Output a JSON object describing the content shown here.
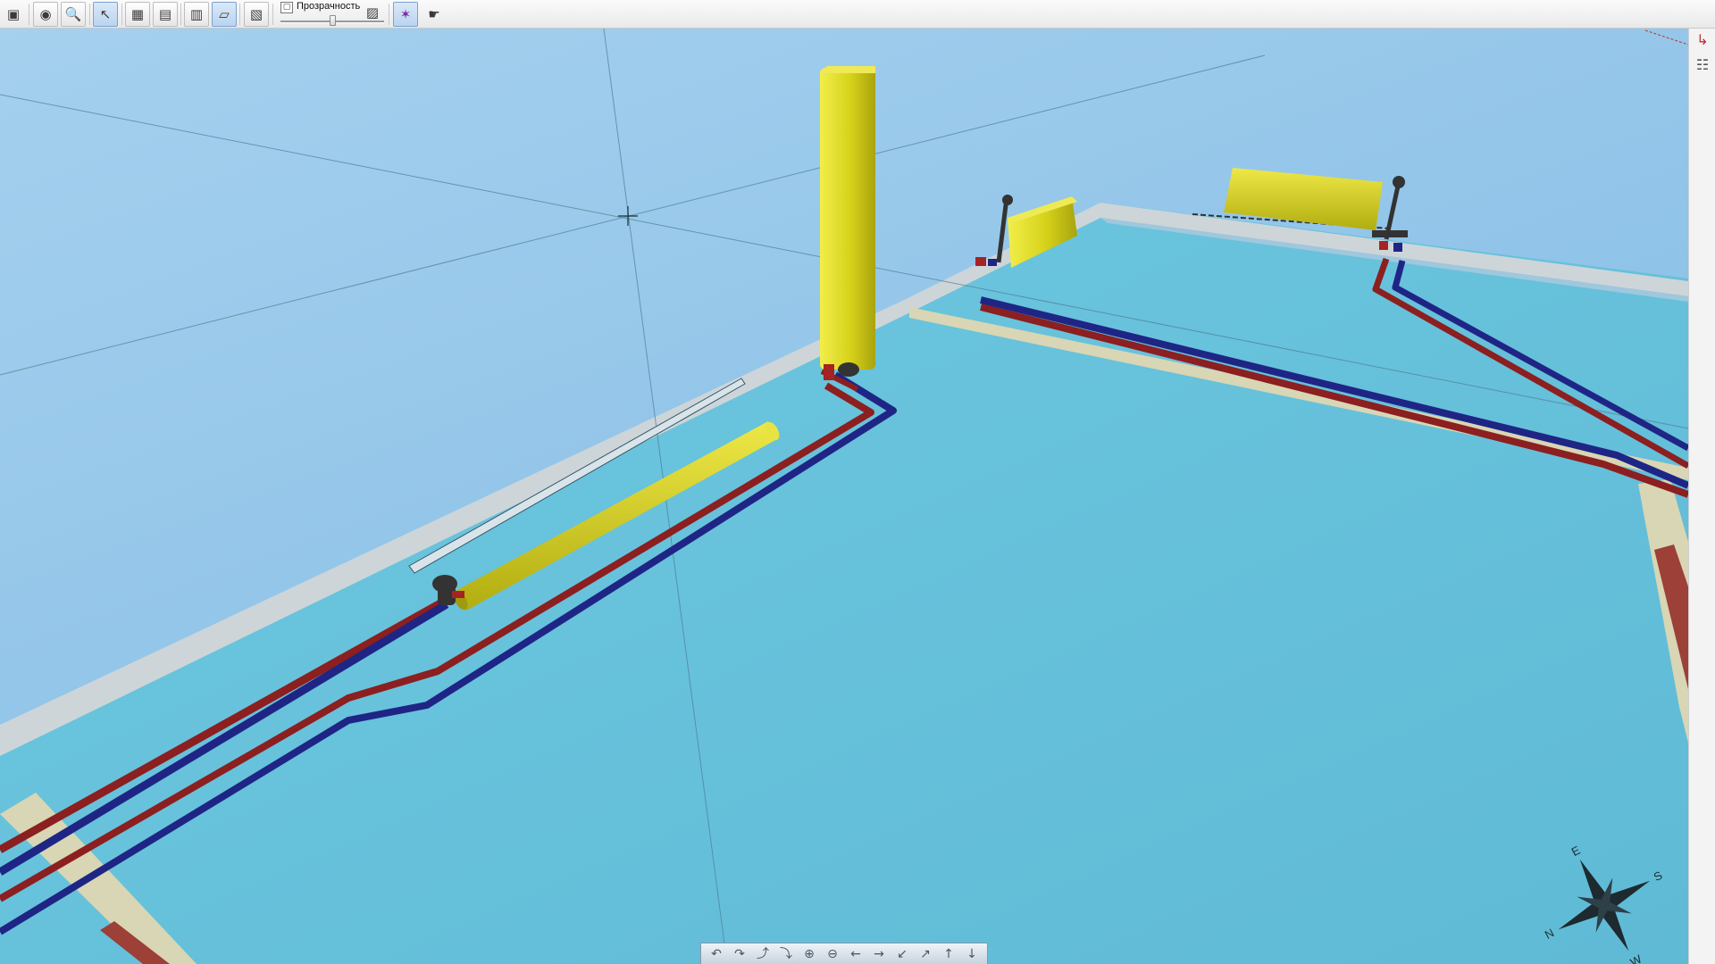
{
  "toolbar": {
    "transparency_label": "Прозрачность",
    "transparency_level": 0.5,
    "buttons": [
      {
        "name": "view-window-icon",
        "glyph": "▣"
      },
      {
        "name": "show-objects-icon",
        "glyph": "◉"
      },
      {
        "name": "zoom-icon",
        "glyph": "🔍"
      },
      {
        "name": "select-pointer-icon",
        "glyph": "↖"
      },
      {
        "name": "floor-plan-icon",
        "glyph": "▦"
      },
      {
        "name": "walls-view-icon",
        "glyph": "▤"
      },
      {
        "name": "section-view-icon",
        "glyph": "▥"
      },
      {
        "name": "floor-layer-icon",
        "glyph": "▱"
      },
      {
        "name": "layers-icon",
        "glyph": "▧"
      },
      {
        "name": "render-settings-icon",
        "glyph": "▨"
      },
      {
        "name": "snap-axes-icon",
        "glyph": "✶"
      },
      {
        "name": "walk-mode-icon",
        "glyph": "☛"
      }
    ]
  },
  "side_panel": {
    "icons": [
      {
        "name": "axes-gizmo-icon",
        "glyph": "↳"
      },
      {
        "name": "scene-tree-icon",
        "glyph": "☷"
      }
    ]
  },
  "compass": {
    "labels": [
      "N",
      "E",
      "S",
      "W"
    ]
  },
  "nav_bar": {
    "buttons": [
      {
        "name": "rotate-left-icon",
        "glyph": "↶"
      },
      {
        "name": "rotate-right-icon",
        "glyph": "↷"
      },
      {
        "name": "tilt-up-icon",
        "glyph": "⤴"
      },
      {
        "name": "tilt-down-icon",
        "glyph": "⤵"
      },
      {
        "name": "zoom-in-icon",
        "glyph": "⊕"
      },
      {
        "name": "zoom-out-icon",
        "glyph": "⊖"
      },
      {
        "name": "pan-left-icon",
        "glyph": "←"
      },
      {
        "name": "pan-right-icon",
        "glyph": "→"
      },
      {
        "name": "move-down-icon",
        "glyph": "↙"
      },
      {
        "name": "move-up-icon",
        "glyph": "↗"
      },
      {
        "name": "raise-icon",
        "glyph": "↑"
      },
      {
        "name": "lower-icon",
        "glyph": "↓"
      }
    ]
  },
  "colors": {
    "sky": "#8fc3e8",
    "floor": "#68c3dc",
    "wall": "#cfd6d8",
    "radiator": "#d6d21a",
    "supply_pipe": "#8c1f1f",
    "return_pipe": "#1f2585",
    "baseboard": "#d8d6b4"
  }
}
